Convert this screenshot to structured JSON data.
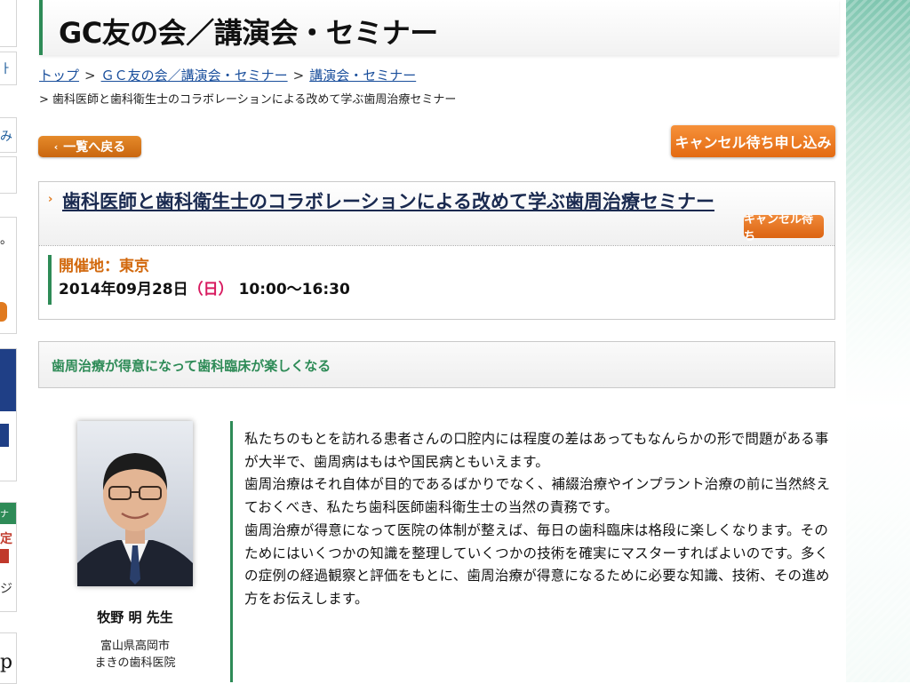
{
  "header": {
    "title": "GC友の会／講演会・セミナー"
  },
  "breadcrumb": {
    "items": [
      "トップ",
      "ＧＣ友の会／講演会・セミナー",
      "講演会・セミナー"
    ],
    "separator": ">",
    "current": "> 歯科医師と歯科衛生士のコラボレーションによる改めて学ぶ歯周治療セミナー"
  },
  "actions": {
    "back_label": "一覧へ戻る",
    "cancel_wait_apply_label": "キャンセル待ち申し込み"
  },
  "event": {
    "title": "歯科医師と歯科衛生士のコラボレーションによる改めて学ぶ歯周治療セミナー",
    "status_badge": "キャンセル待ち",
    "venue": "開催地：東京",
    "date": "2014年09月28日",
    "weekday": "（日）",
    "time": "10:00〜16:30"
  },
  "tagline": "歯周治療が得意になって歯科臨床が楽しくなる",
  "lecturer": {
    "name": "牧野 明 先生",
    "city": "富山県高岡市",
    "clinic": "まきの歯科医院"
  },
  "description": {
    "p1": "私たちのもとを訪れる患者さんの口腔内には程度の差はあってもなんらかの形で問題がある事が大半で、歯周病はもはや国民病ともいえます。",
    "p2": "歯周治療はそれ自体が目的であるばかりでなく、補綴治療やインプラント治療の前に当然終えておくべき、私たち歯科医師歯科衛生士の当然の責務です。",
    "p3": "歯周治療が得意になって医院の体制が整えば、毎日の歯科臨床は格段に楽しくなります。そのためにはいくつかの知識を整理していくつかの技術を確実にマスターすればよいのです。多くの症例の経過観察と評価をもとに、歯周治療が得意になるために必要な知識、技術、その進め方をお伝えします。"
  },
  "sidebar_fragments": {
    "c1": "ㅏ",
    "c2": "み",
    "c3": "。",
    "c4": "定",
    "c5": "ジ",
    "c6": "p",
    "c7": "ナー"
  },
  "colors": {
    "accent_green": "#2e8b57",
    "button_orange": "#e36a12",
    "link_blue": "#1a4f9c",
    "venue_orange": "#d2690e",
    "weekday_pink": "#d81b60"
  }
}
